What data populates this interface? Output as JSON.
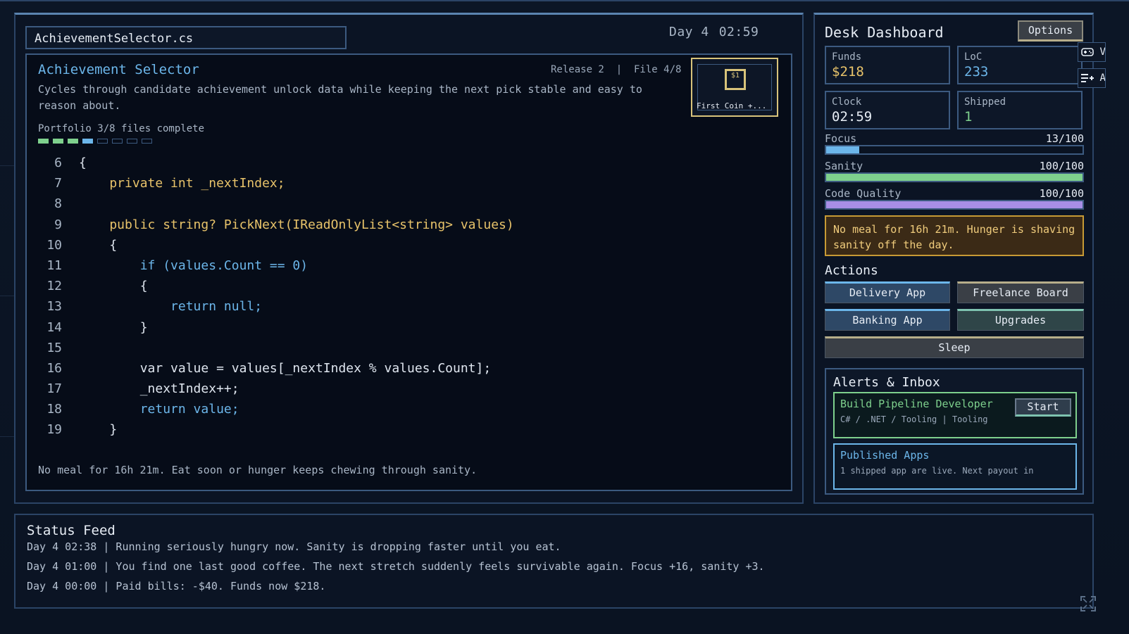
{
  "header": {
    "file_name": "AchievementSelector.cs",
    "day": "Day 4",
    "time": "02:59"
  },
  "editor": {
    "title": "Achievement Selector",
    "meta": "Release 2  |  File 4/8",
    "description": "Cycles through candidate achievement unlock data while keeping the next pick stable and easy to reason about.",
    "portfolio": "Portfolio 3/8 files complete",
    "portfolio_done": 3,
    "portfolio_total": 8,
    "badge_label": "First Coin  +...",
    "badge_coin": "$1",
    "code": [
      {
        "n": "6",
        "indent": 0,
        "text": "{",
        "style": "plain"
      },
      {
        "n": "7",
        "indent": 1,
        "text": "private int _nextIndex;",
        "style": "yellow"
      },
      {
        "n": "8",
        "indent": 0,
        "text": "",
        "style": "plain"
      },
      {
        "n": "9",
        "indent": 1,
        "text": "public string? PickNext(IReadOnlyList<string> values)",
        "style": "yellow"
      },
      {
        "n": "10",
        "indent": 1,
        "text": "{",
        "style": "plain"
      },
      {
        "n": "11",
        "indent": 2,
        "text": "if (values.Count == 0)",
        "style": "blue"
      },
      {
        "n": "12",
        "indent": 2,
        "text": "{",
        "style": "plain"
      },
      {
        "n": "13",
        "indent": 3,
        "text": "return null;",
        "style": "blue"
      },
      {
        "n": "14",
        "indent": 2,
        "text": "}",
        "style": "plain"
      },
      {
        "n": "15",
        "indent": 0,
        "text": "",
        "style": "plain"
      },
      {
        "n": "16",
        "indent": 2,
        "text": "var value = values[_nextIndex % values.Count];",
        "style": "plain"
      },
      {
        "n": "17",
        "indent": 2,
        "text": "_nextIndex++;",
        "style": "plain"
      },
      {
        "n": "18",
        "indent": 2,
        "text": "return value;",
        "style": "blue"
      },
      {
        "n": "19",
        "indent": 1,
        "text": "}",
        "style": "plain"
      }
    ],
    "footer": "No meal for 16h 21m. Eat soon or hunger keeps chewing through sanity."
  },
  "dashboard": {
    "title": "Desk Dashboard",
    "options_label": "Options",
    "stats": {
      "funds_label": "Funds",
      "funds_value": "$218",
      "loc_label": "LoC",
      "loc_value": "233",
      "clock_label": "Clock",
      "clock_value": "02:59",
      "shipped_label": "Shipped",
      "shipped_value": "1"
    },
    "meters": [
      {
        "label": "Focus",
        "value_text": "13/100",
        "value": 13,
        "color": "#6cb6ea"
      },
      {
        "label": "Sanity",
        "value_text": "100/100",
        "value": 100,
        "color": "#7ed08d"
      },
      {
        "label": "Code Quality",
        "value_text": "100/100",
        "value": 100,
        "color": "#a78ee6"
      }
    ],
    "warning": "No meal for 16h 21m. Hunger is shaving sanity off the day.",
    "actions_title": "Actions",
    "actions": {
      "delivery": "Delivery App",
      "freelance": "Freelance Board",
      "banking": "Banking App",
      "upgrades": "Upgrades",
      "sleep": "Sleep"
    },
    "inbox_title": "Alerts & Inbox",
    "job": {
      "title": "Build Pipeline Developer",
      "sub": "C# / .NET / Tooling | Tooling",
      "start_label": "Start"
    },
    "published": {
      "title": "Published Apps",
      "sub": "1 shipped app are live. Next payout in"
    },
    "edge_icons": [
      "V",
      "A"
    ]
  },
  "feed": {
    "title": "Status Feed",
    "lines": [
      "Day 4 02:38 | Running seriously hungry now. Sanity is dropping faster until you eat.",
      "Day 4 01:00 | You find one last good coffee. The next stretch suddenly feels survivable again. Focus +16, sanity +3.",
      "Day 4 00:00 | Paid bills: -$40. Funds now $218."
    ]
  },
  "colors": {
    "accent_blue": "#6cb6ea",
    "accent_green": "#7ed08d",
    "accent_yellow": "#e8c36a",
    "accent_purple": "#a78ee6",
    "warning_border": "#c79a35"
  }
}
